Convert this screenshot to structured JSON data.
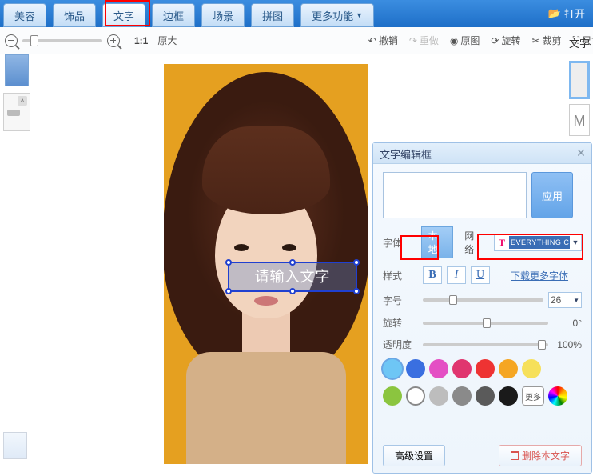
{
  "tabs": {
    "beauty": "美容",
    "accessory": "饰品",
    "text": "文字",
    "border": "边框",
    "scene": "场景",
    "collage": "拼图",
    "more": "更多功能"
  },
  "open_label": "打开",
  "toolbar": {
    "ratio": "1:1",
    "original": "原大",
    "undo": "撤销",
    "redo": "重做",
    "orig_img": "原图",
    "rotate": "旋转",
    "crop": "裁剪",
    "size": "尺寸"
  },
  "right_label": "文字",
  "right_m": "M",
  "canvas_text_placeholder": "请输入文字",
  "panel": {
    "title": "文字编辑框",
    "apply": "应用",
    "font_label": "字体",
    "tab_local": "本地",
    "tab_net": "网络",
    "font_name": "EVERYTHING C",
    "style_label": "样式",
    "bold": "B",
    "italic": "I",
    "underline": "U",
    "more_fonts": "下载更多字体",
    "size_label": "字号",
    "size_value": "26",
    "rotate_label": "旋转",
    "rotate_value": "0°",
    "opacity_label": "透明度",
    "opacity_value": "100%",
    "more_color": "更多",
    "advanced": "高级设置",
    "delete": "删除本文字"
  },
  "colors_row1": [
    "#6ec6f5",
    "#3a6fe0",
    "#e44fc4",
    "#e0356f",
    "#e33",
    "#f5a623",
    "#f6e05a"
  ],
  "colors_row2": [
    "#8bc53f",
    "hollow",
    "#bdbdbd",
    "#8a8a8a",
    "#5a5a5a",
    "#1a1a1a"
  ]
}
